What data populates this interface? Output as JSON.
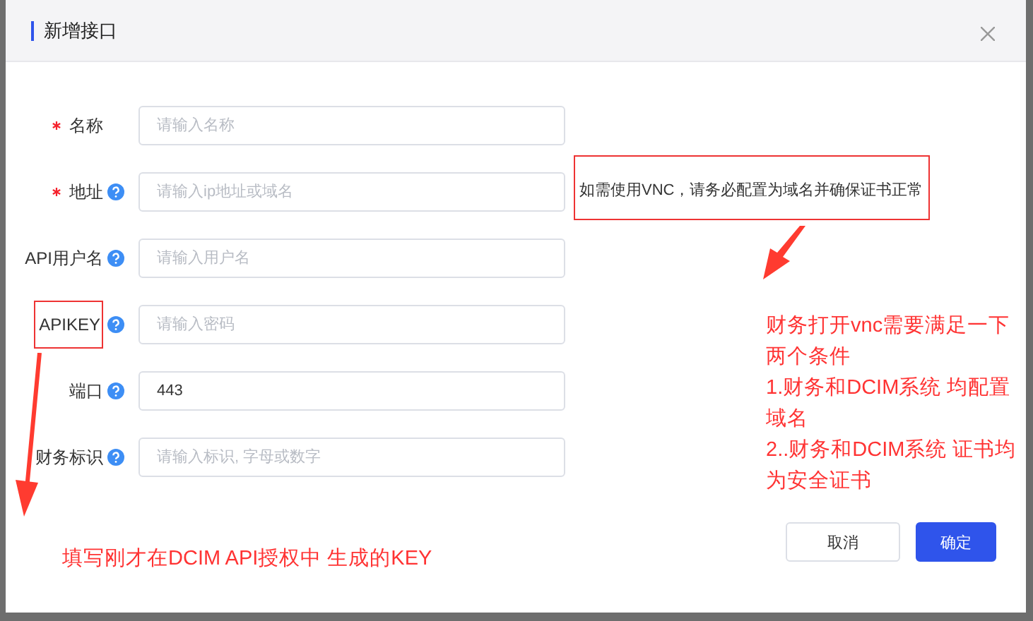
{
  "dialog": {
    "title": "新增接口"
  },
  "fields": [
    {
      "label": "名称",
      "required": true,
      "help": false,
      "placeholder": "请输入名称",
      "highlighted": false
    },
    {
      "label": "地址",
      "required": true,
      "help": true,
      "placeholder": "请输入ip地址或域名",
      "highlighted": false,
      "note": "如需使用VNC，请务必配置为域名并确保证书正常"
    },
    {
      "label": "API用户名",
      "required": false,
      "help": true,
      "placeholder": "请输入用户名",
      "highlighted": false
    },
    {
      "label": "APIKEY",
      "required": false,
      "help": true,
      "placeholder": "请输入密码",
      "highlighted": true
    },
    {
      "label": "端口",
      "required": false,
      "help": true,
      "value": "443",
      "highlighted": false
    },
    {
      "label": "财务标识",
      "required": false,
      "help": true,
      "placeholder": "请输入标识, 字母或数字",
      "highlighted": false
    }
  ],
  "annotations": {
    "conditions": [
      "财务打开vnc需要满足一下两个条件",
      "1.财务和DCIM系统 均配置域名",
      "2..财务和DCIM系统 证书均为安全证书"
    ],
    "key_hint": "填写刚才在DCIM API授权中 生成的KEY"
  },
  "buttons": [
    {
      "label": "取消",
      "kind": "default"
    },
    {
      "label": "确定",
      "kind": "primary"
    }
  ]
}
